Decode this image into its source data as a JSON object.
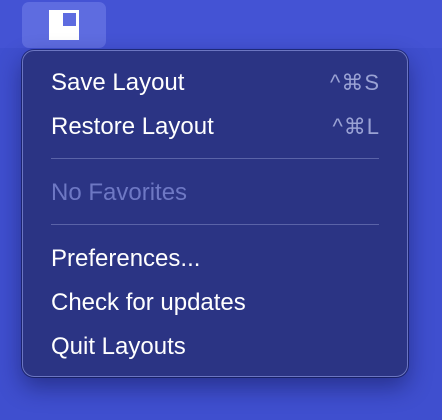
{
  "status_item": {
    "icon": "layouts-app-icon"
  },
  "menu": {
    "items": [
      {
        "label": "Save Layout",
        "shortcut": "^⌘S"
      },
      {
        "label": "Restore Layout",
        "shortcut": "^⌘L"
      },
      {
        "label": "No Favorites",
        "disabled": true
      },
      {
        "label": "Preferences..."
      },
      {
        "label": "Check for updates"
      },
      {
        "label": "Quit Layouts"
      }
    ]
  },
  "colors": {
    "background": "#3f4fcf",
    "menu_background": "#2b3484",
    "text": "#ffffff",
    "disabled_text": "#6e78c4",
    "shortcut_text": "#9aa2d4"
  }
}
